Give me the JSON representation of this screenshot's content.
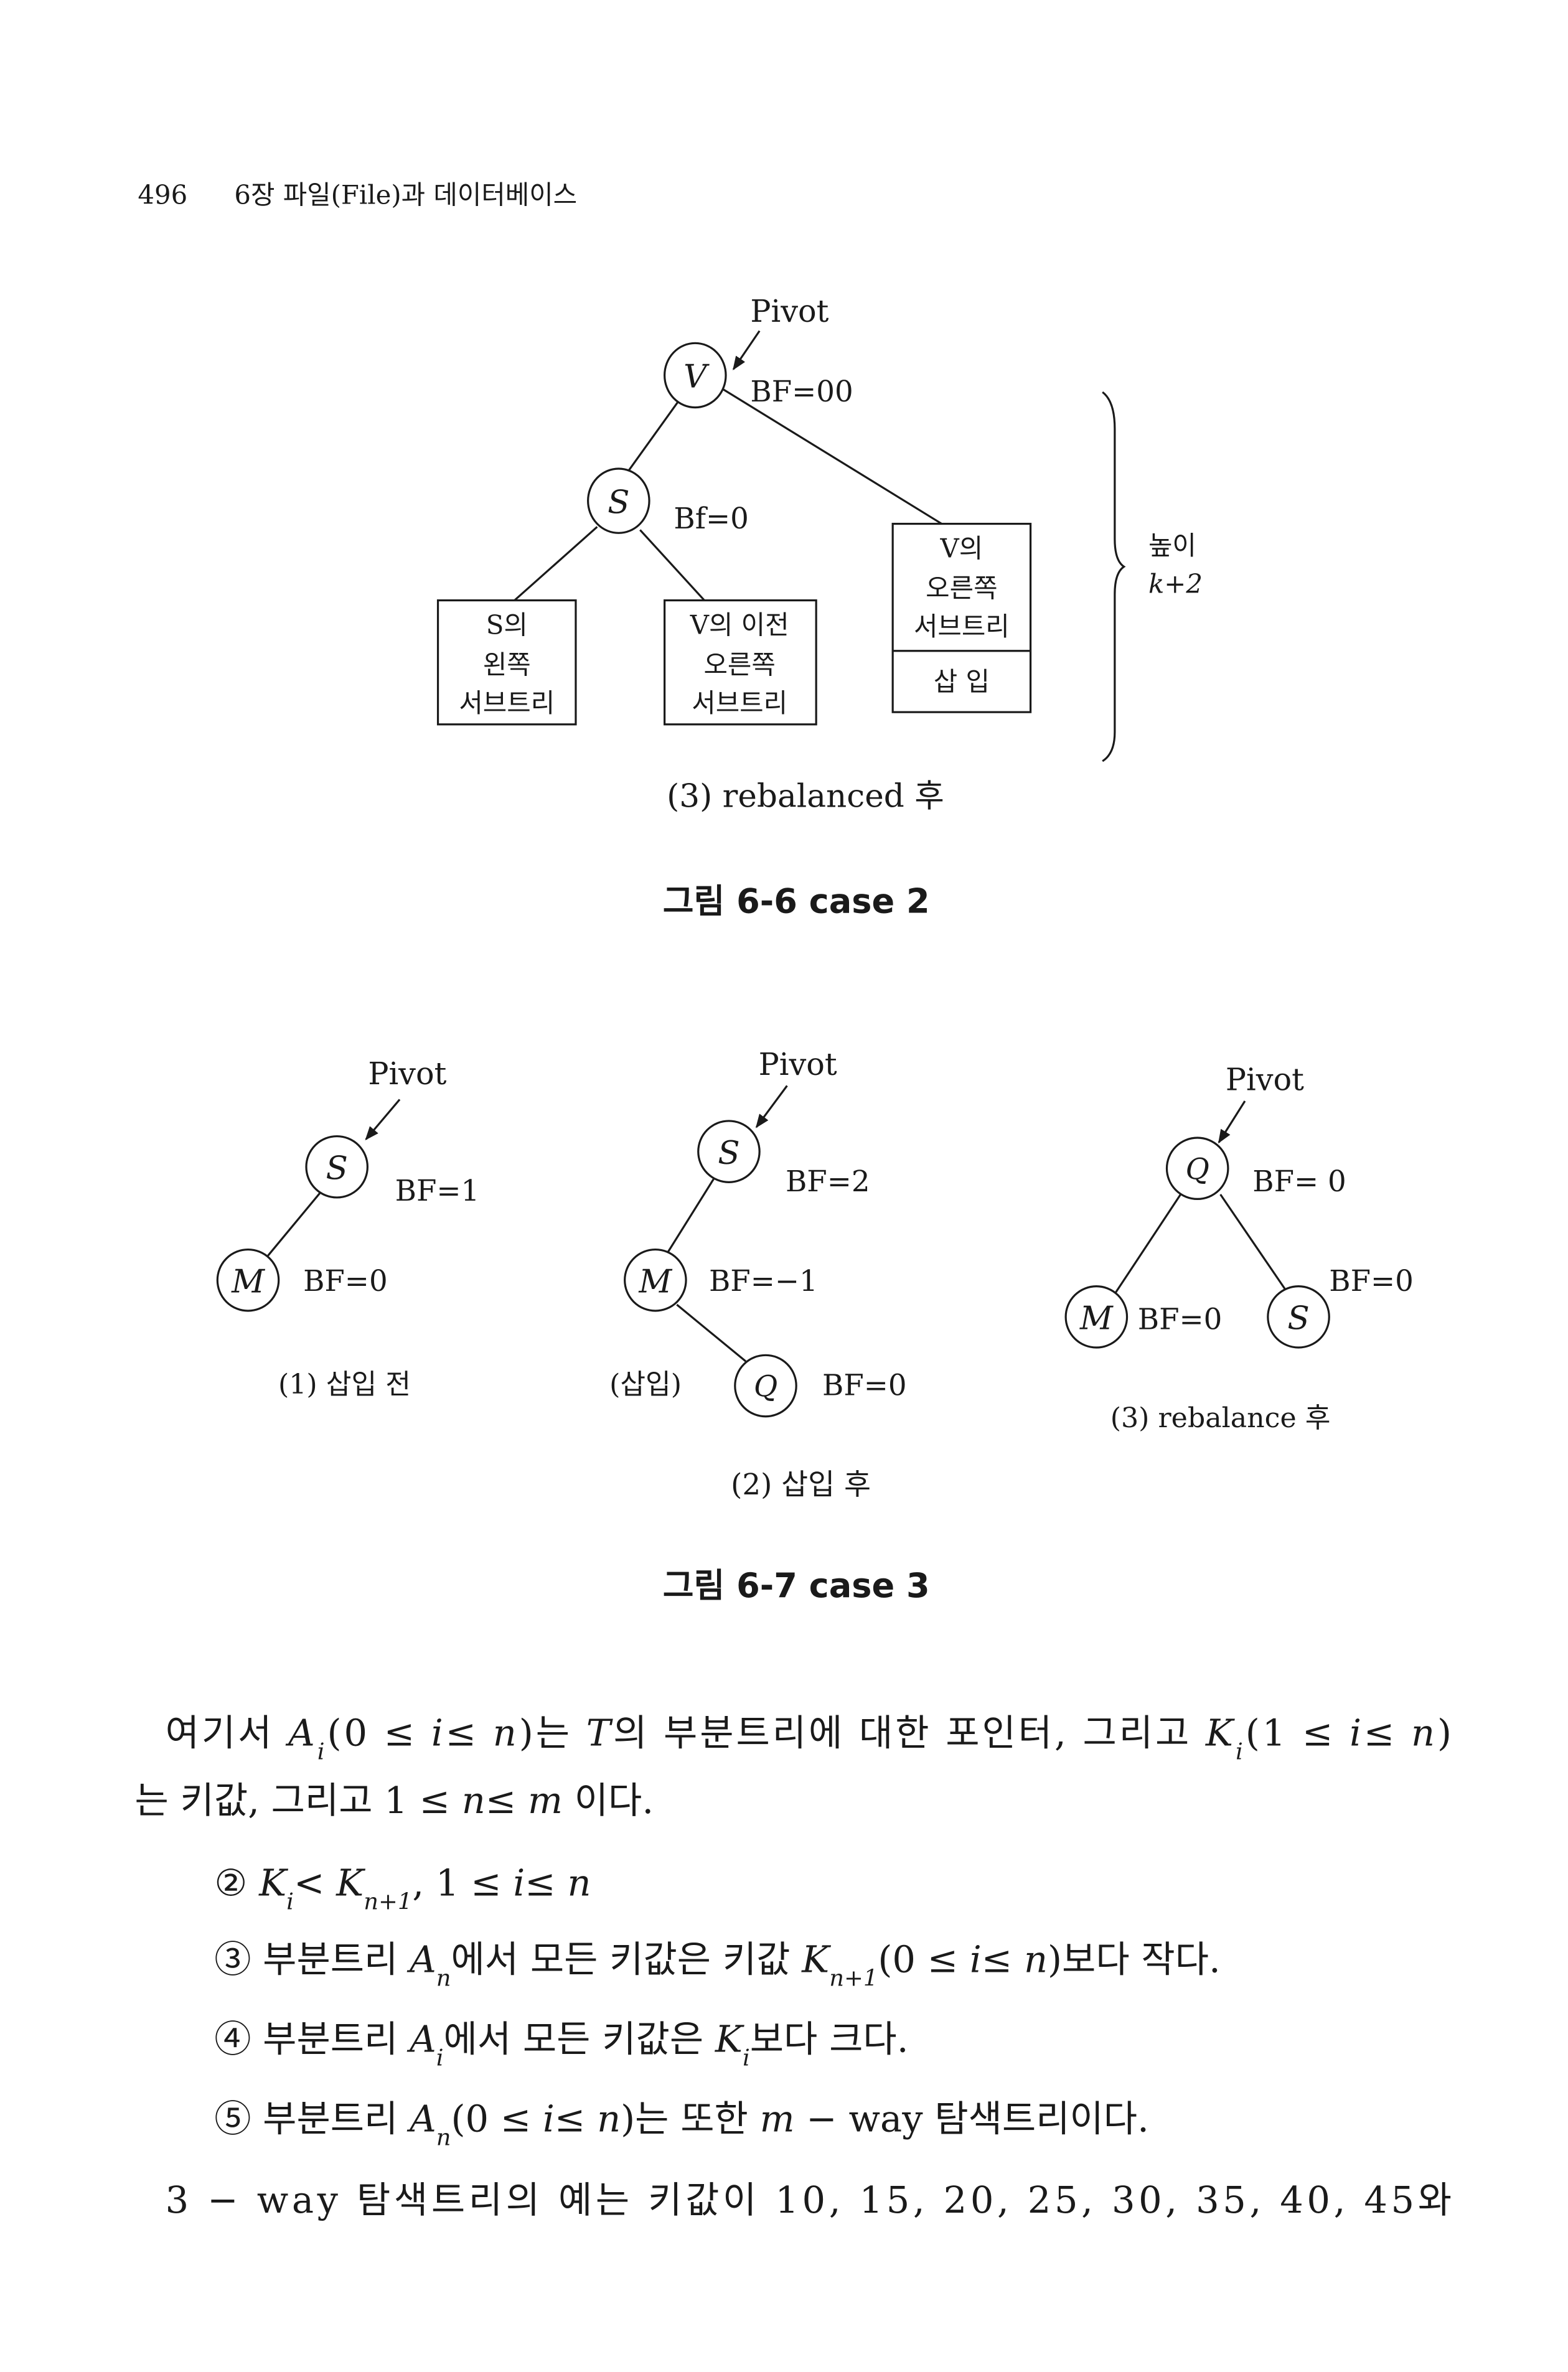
{
  "header": {
    "page_number": "496",
    "chapter": "6장  파일(File)과 데이터베이스"
  },
  "figure_6_6": {
    "pivot_label": "Pivot",
    "root": {
      "label": "V",
      "bf": "BF=00"
    },
    "child": {
      "label": "S",
      "bf": "Bf=0"
    },
    "boxes": {
      "left": [
        "S의",
        "왼쪽",
        "서브트리"
      ],
      "middle": [
        "V의 이전",
        "오른쪽",
        "서브트리"
      ],
      "right": [
        "V의",
        "오른쪽",
        "서브트리"
      ],
      "right_insert": "삽 입"
    },
    "height_label": [
      "높이",
      "k+2"
    ],
    "subcaption": "(3) rebalanced 후",
    "caption": "그림 6-6  case 2"
  },
  "figure_6_7": {
    "panel1": {
      "pivot": "Pivot",
      "s": "S",
      "s_bf": "BF=1",
      "m": "M",
      "m_bf": "BF=0",
      "caption": "(1) 삽입 전"
    },
    "panel2": {
      "pivot": "Pivot",
      "s": "S",
      "s_bf": "BF=2",
      "m": "M",
      "m_bf": "BF=−1",
      "q": "Q",
      "q_bf": "BF=0",
      "insert": "(삽입)",
      "caption": "(2) 삽입 후"
    },
    "panel3": {
      "pivot": "Pivot",
      "q": "Q",
      "q_bf": "BF= 0",
      "m": "M",
      "m_bf": "BF=0",
      "s": "S",
      "s_bf": "BF=0",
      "caption": "(3) rebalance 후"
    },
    "caption": "그림 6-7  case 3"
  },
  "body": {
    "lines": [
      [
        [
          "여기서 ",
          ""
        ],
        [
          "A",
          "i"
        ],
        [
          "i",
          "sub"
        ],
        [
          "(0 ≤ ",
          ""
        ],
        [
          "i",
          "i"
        ],
        [
          "≤ ",
          ""
        ],
        [
          "n",
          "i"
        ],
        [
          ")는 ",
          ""
        ],
        [
          "T",
          "i"
        ],
        [
          "의 부분트리에 대한 포인터, 그리고 ",
          ""
        ],
        [
          "K",
          "i"
        ],
        [
          "i",
          "sub"
        ],
        [
          "(1 ≤ ",
          ""
        ],
        [
          "i",
          "i"
        ],
        [
          "≤ ",
          ""
        ],
        [
          "n",
          "i"
        ],
        [
          ")",
          ""
        ]
      ],
      [
        [
          "는 키값, 그리고 1 ≤ ",
          ""
        ],
        [
          "n",
          "i"
        ],
        [
          "≤ ",
          ""
        ],
        [
          "m",
          "i"
        ],
        [
          " 이다.",
          ""
        ]
      ],
      [
        [
          "② ",
          ""
        ],
        [
          "K",
          "i"
        ],
        [
          "i",
          "sub"
        ],
        [
          "< ",
          ""
        ],
        [
          "K",
          "i"
        ],
        [
          "n+1",
          "sub"
        ],
        [
          ", 1 ≤ ",
          ""
        ],
        [
          "i",
          "i"
        ],
        [
          "≤ ",
          ""
        ],
        [
          "n",
          "i"
        ]
      ],
      [
        [
          "③ 부분트리 ",
          ""
        ],
        [
          "A",
          "i"
        ],
        [
          "n",
          "sub"
        ],
        [
          "에서 모든 키값은 키값 ",
          ""
        ],
        [
          "K",
          "i"
        ],
        [
          "n+1",
          "sub"
        ],
        [
          "(0 ≤ ",
          ""
        ],
        [
          "i",
          "i"
        ],
        [
          "≤ ",
          ""
        ],
        [
          "n",
          "i"
        ],
        [
          ")보다 작다.",
          ""
        ]
      ],
      [
        [
          "④ 부분트리 ",
          ""
        ],
        [
          "A",
          "i"
        ],
        [
          "i",
          "sub"
        ],
        [
          "에서 모든 키값은 ",
          ""
        ],
        [
          "K",
          "i"
        ],
        [
          "i",
          "sub"
        ],
        [
          "보다 크다.",
          ""
        ]
      ],
      [
        [
          "⑤ 부분트리 ",
          ""
        ],
        [
          "A",
          "i"
        ],
        [
          "n",
          "sub"
        ],
        [
          "(0 ≤ ",
          ""
        ],
        [
          "i",
          "i"
        ],
        [
          "≤ ",
          ""
        ],
        [
          "n",
          "i"
        ],
        [
          ")는 또한 ",
          ""
        ],
        [
          "m",
          "i"
        ],
        [
          " − way 탐색트리이다.",
          ""
        ]
      ],
      [
        [
          "3 − way 탐색트리의 예는 키값이 10, 15, 20, 25, 30, 35, 40, 45와",
          ""
        ]
      ]
    ]
  }
}
